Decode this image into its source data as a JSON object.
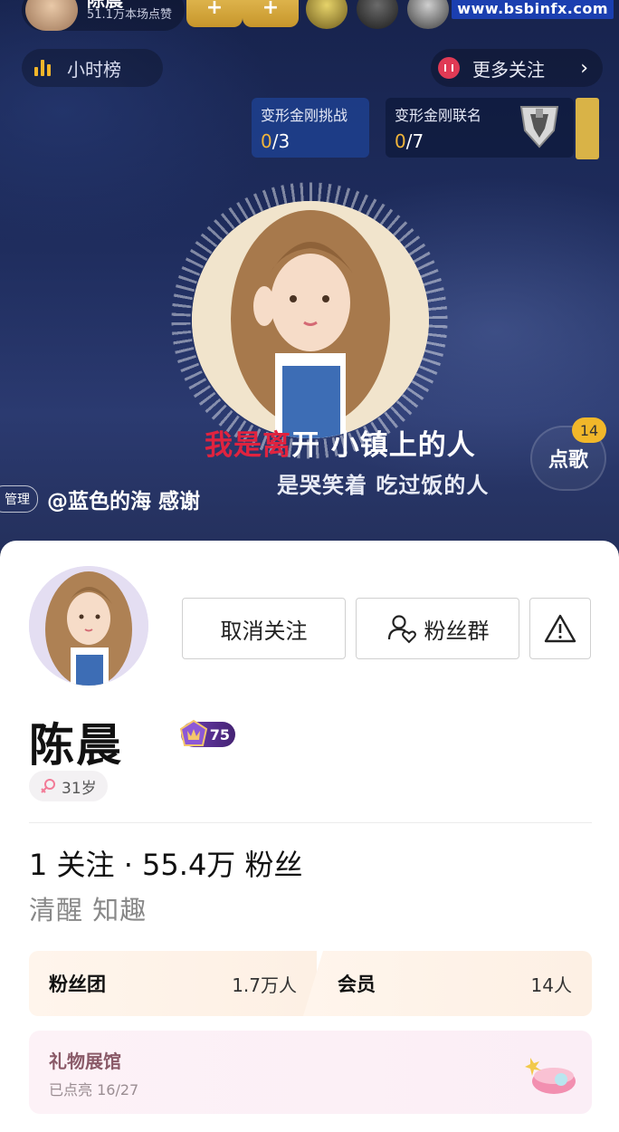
{
  "watermark": "www.bsbinfx.com",
  "live": {
    "host_name": "陈晨",
    "host_likes": "51.1万本场点赞",
    "rank_label": "小时榜",
    "more_follow_label": "更多关注",
    "challenges": [
      {
        "title": "变形金刚挑战",
        "current": "0",
        "total": "/3"
      },
      {
        "title": "变形金刚联名",
        "current": "0",
        "total": "/7"
      }
    ],
    "lyric_highlight": "我是离",
    "lyric_rest": "开 小镇上的人",
    "lyric_next": "是哭笑着 吃过饭的人",
    "song_button_label": "点歌",
    "song_count": "14",
    "chat_tag": "管理",
    "chat_text": "@蓝色的海 感谢"
  },
  "profile": {
    "unfollow_label": "取消关注",
    "fans_group_label": "粉丝群",
    "name": "陈晨",
    "level": "75",
    "age": "31岁",
    "stats": "1 关注 · 55.4万 粉丝",
    "bio": "清醒 知趣",
    "fan_club_label": "粉丝团",
    "fan_club_count": "1.7万人",
    "member_label": "会员",
    "member_count": "14人",
    "gallery_title": "礼物展馆",
    "gallery_sub": "已点亮 16/27"
  },
  "colors": {
    "accent_gold": "#f1b72a",
    "lyric_red": "#e0233f",
    "level_purple": "#6d3fb4"
  }
}
